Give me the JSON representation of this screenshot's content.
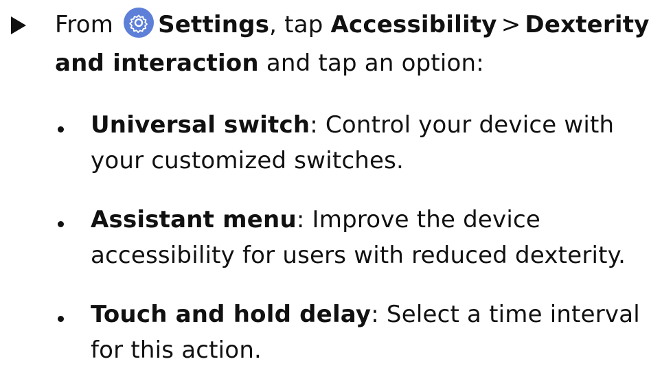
{
  "step": {
    "marker_icon": "play-triangle",
    "from": "From",
    "settings_icon": "gear-icon",
    "settings_icon_color": "#5d7fd8",
    "settings_label": "Settings",
    "tap_text": ", tap",
    "accessibility_label": "Accessibility",
    "separator": ">",
    "menu_label": "Dexterity and interaction",
    "suffix": "and tap an option:"
  },
  "options": [
    {
      "name": "Universal switch",
      "description": ": Control your device with your customized switches."
    },
    {
      "name": "Assistant menu",
      "description": ": Improve the device accessibility for users with reduced dexterity."
    },
    {
      "name": "Touch and hold delay",
      "description": ": Select a time interval for this action."
    }
  ]
}
